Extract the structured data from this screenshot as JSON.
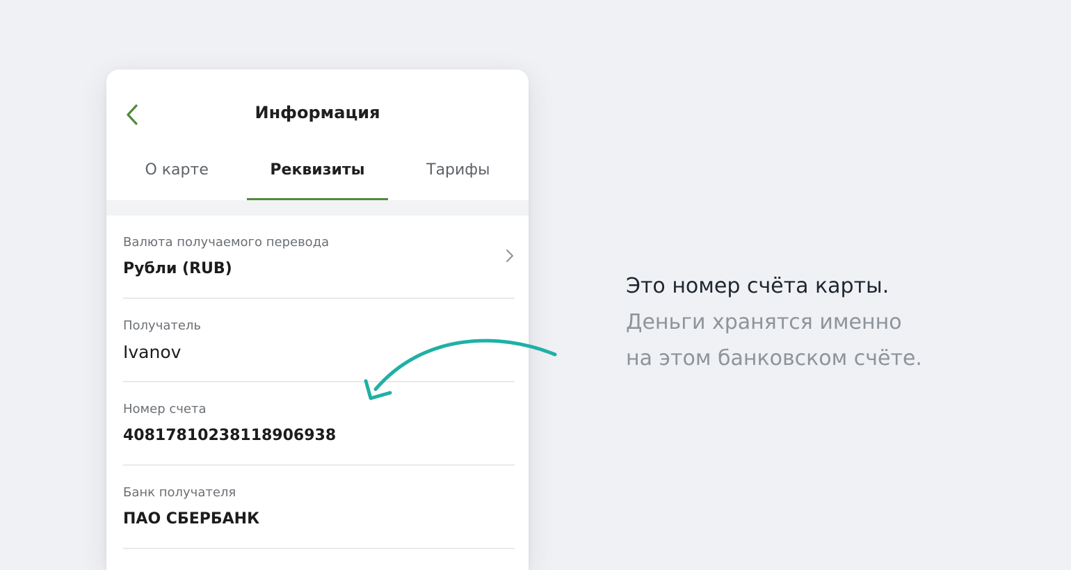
{
  "header": {
    "title": "Информация",
    "back_icon": "chevron-left-icon"
  },
  "tabs": [
    {
      "label": "О карте",
      "active": false
    },
    {
      "label": "Реквизиты",
      "active": true
    },
    {
      "label": "Тарифы",
      "active": false
    }
  ],
  "fields": [
    {
      "label": "Валюта получаемого перевода",
      "value": "Рубли (RUB)",
      "has_chevron": true
    },
    {
      "label": "Получатель",
      "value": "Ivanov"
    },
    {
      "label": "Номер счета",
      "value": "40817810238118906938"
    },
    {
      "label": "Банк получателя",
      "value": "ПАО СБЕРБАНК"
    }
  ],
  "caption": {
    "line1": "Это номер счёта карты.",
    "line2": "Деньги хранятся именно",
    "line3": "на этом банковском счёте."
  },
  "colors": {
    "accent_green": "#4f8a3c",
    "arrow_teal": "#1fb0a6",
    "background": "#f0f1f4"
  }
}
